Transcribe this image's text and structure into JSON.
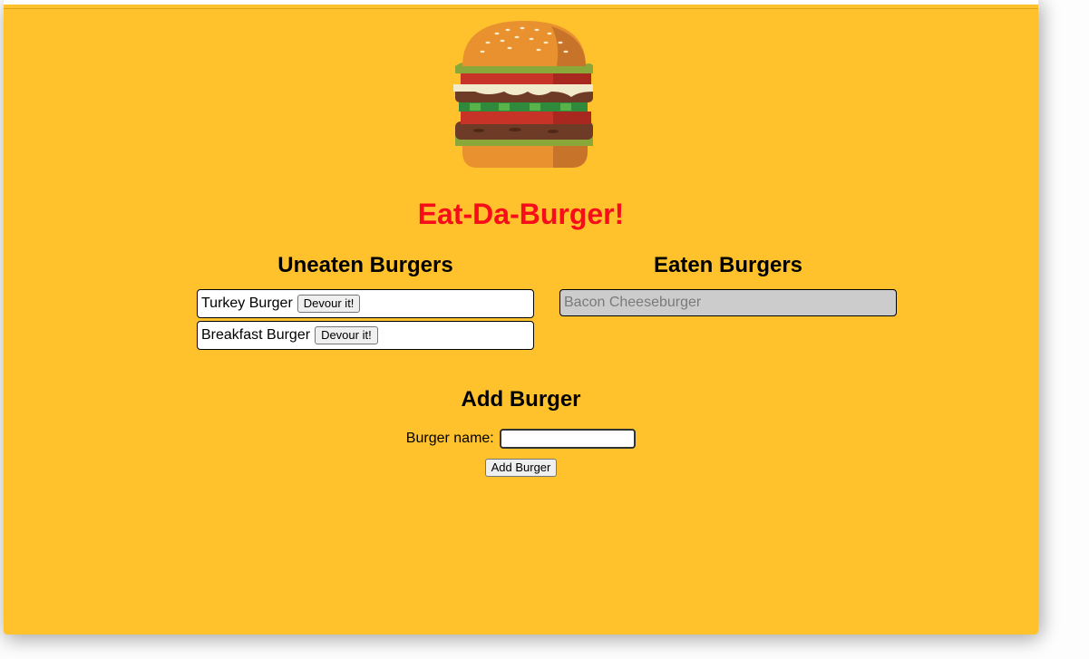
{
  "page": {
    "title": "Eat-Da-Burger!",
    "background_color": "#ffc22d",
    "title_color": "#f70d1a",
    "logo_icon": "hamburger-icon"
  },
  "uneaten": {
    "heading": "Uneaten Burgers",
    "devour_label": "Devour it!",
    "items": [
      {
        "name": "Turkey Burger"
      },
      {
        "name": "Breakfast Burger"
      }
    ]
  },
  "eaten": {
    "heading": "Eaten Burgers",
    "items": [
      {
        "name": "Bacon Cheeseburger"
      }
    ],
    "item_color": "#cccccc"
  },
  "add_form": {
    "heading": "Add Burger",
    "name_label": "Burger name:",
    "name_value": "",
    "submit_label": "Add Burger"
  }
}
